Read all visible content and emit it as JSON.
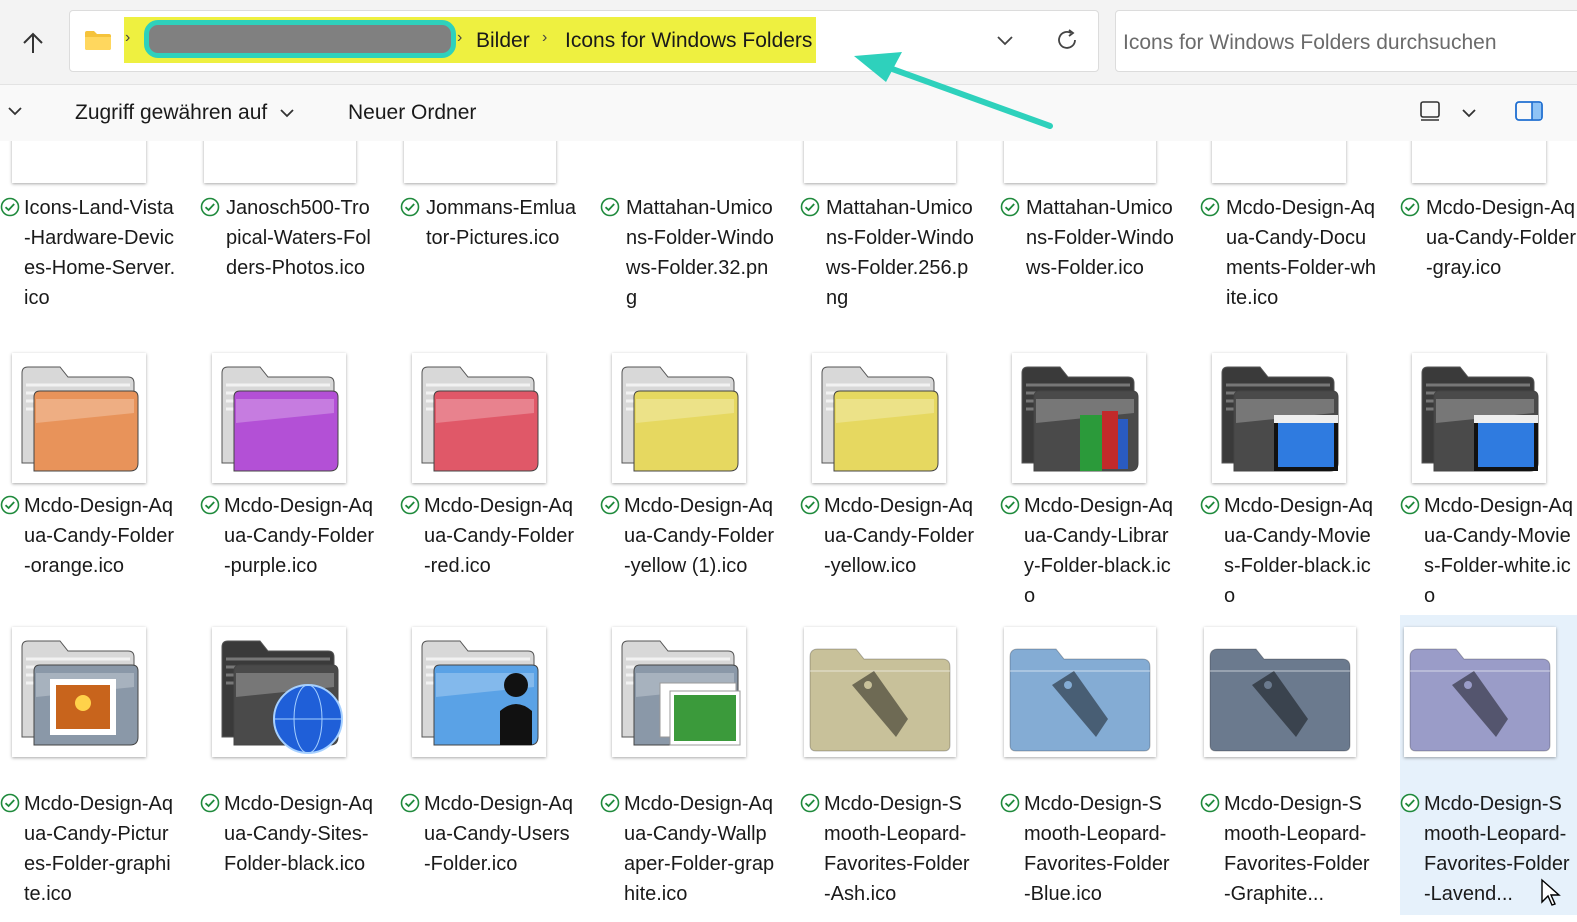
{
  "address": {
    "crumbs": [
      "Bilder",
      "Icons for Windows Folders"
    ],
    "separator": "›"
  },
  "search": {
    "placeholder": "Icons for Windows Folders durchsuchen"
  },
  "command_bar": {
    "access_label": "Zugriff gewähren auf",
    "new_folder_label": "Neuer Ordner"
  },
  "colors": {
    "highlight": "#eef040",
    "annotation": "#2ed1bc",
    "sync_check": "#1f8a3c",
    "selection": "#e6f1fb"
  },
  "rows": [
    {
      "items": [
        {
          "name": "Icons-Land-Vista-Hardware-Devices-Home-Server.ico",
          "icon": "server-icon"
        },
        {
          "name": "Janosch500-Tropical-Waters-Folders-Photos.ico",
          "icon": "teal-folder-icon"
        },
        {
          "name": "Jommans-Emluator-Pictures.ico",
          "icon": "pictures-icon"
        },
        {
          "name": "Mattahan-Umicons-Folder-Windows-Folder.32.png",
          "icon": "small-image-icon"
        },
        {
          "name": "Mattahan-Umicons-Folder-Windows-Folder.256.png",
          "icon": "binoculars-icon"
        },
        {
          "name": "Mattahan-Umicons-Folder-Windows-Folder.ico",
          "icon": "binoculars-icon"
        },
        {
          "name": "Mcdo-Design-Aqua-Candy-Documents-Folder-white.ico",
          "icon": "glasses-folder-icon"
        },
        {
          "name": "Mcdo-Design-Aqua-Candy-Folder-gray.ico",
          "icon": "gray-folder-icon"
        }
      ]
    },
    {
      "items": [
        {
          "name": "Mcdo-Design-Aqua-Candy-Folder-orange.ico",
          "icon": "orange-folder-icon"
        },
        {
          "name": "Mcdo-Design-Aqua-Candy-Folder-purple.ico",
          "icon": "purple-folder-icon"
        },
        {
          "name": "Mcdo-Design-Aqua-Candy-Folder-red.ico",
          "icon": "red-folder-icon"
        },
        {
          "name": "Mcdo-Design-Aqua-Candy-Folder-yellow (1).ico",
          "icon": "yellow-folder-icon"
        },
        {
          "name": "Mcdo-Design-Aqua-Candy-Folder-yellow.ico",
          "icon": "yellow-folder-icon"
        },
        {
          "name": "Mcdo-Design-Aqua-Candy-Library-Folder-black.ico",
          "icon": "library-folder-icon"
        },
        {
          "name": "Mcdo-Design-Aqua-Candy-Movies-Folder-black.ico",
          "icon": "movies-folder-icon"
        },
        {
          "name": "Mcdo-Design-Aqua-Candy-Movies-Folder-white.ico",
          "icon": "movies-folder-icon"
        }
      ]
    },
    {
      "items": [
        {
          "name": "Mcdo-Design-Aqua-Candy-Pictures-Folder-graphite.ico",
          "icon": "pictures-folder-icon"
        },
        {
          "name": "Mcdo-Design-Aqua-Candy-Sites-Folder-black.ico",
          "icon": "sites-folder-icon"
        },
        {
          "name": "Mcdo-Design-Aqua-Candy-Users-Folder.ico",
          "icon": "users-folder-icon"
        },
        {
          "name": "Mcdo-Design-Aqua-Candy-Wallpaper-Folder-graphite.ico",
          "icon": "wallpaper-folder-icon"
        },
        {
          "name": "Mcdo-Design-Smooth-Leopard-Favorites-Folder-Ash.ico",
          "icon": "favorites-folder-icon"
        },
        {
          "name": "Mcdo-Design-Smooth-Leopard-Favorites-Folder-Blue.ico",
          "icon": "favorites-folder-icon"
        },
        {
          "name": "Mcdo-Design-Smooth-Leopard-Favorites-Folder-Graphite...",
          "icon": "favorites-folder-icon"
        },
        {
          "name": "Mcdo-Design-Smooth-Leopard-Favorites-Folder-Lavend...",
          "icon": "favorites-folder-icon"
        }
      ]
    }
  ]
}
